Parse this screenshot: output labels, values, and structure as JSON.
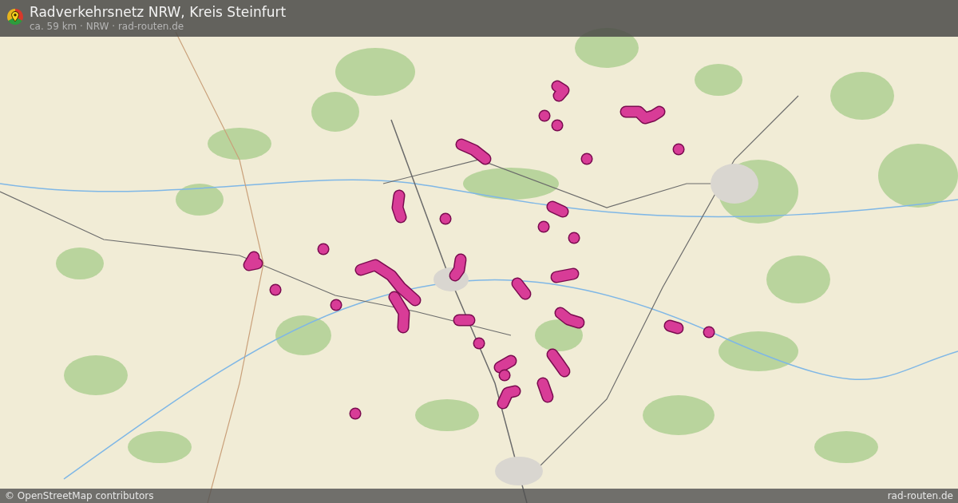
{
  "header": {
    "title": "Radverkehrsnetz NRW, Kreis Steinfurt",
    "subtitle": "ca. 59 km · NRW · rad-routen.de"
  },
  "footer": {
    "attribution": "© OpenStreetMap contributors",
    "site": "rad-routen.de"
  }
}
